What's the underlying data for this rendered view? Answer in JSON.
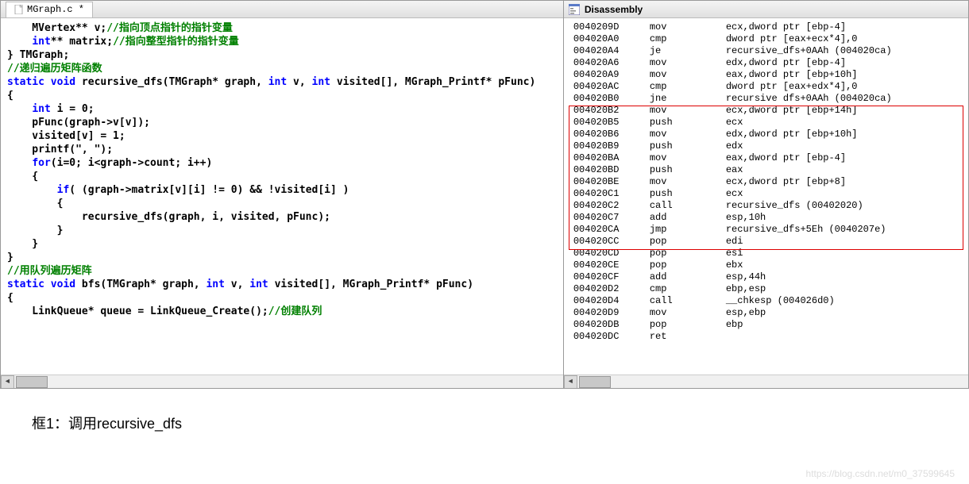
{
  "editor": {
    "tab_name": "MGraph.c *",
    "code_lines": [
      {
        "segments": [
          {
            "t": "    MVertex** v;",
            "c": "id"
          },
          {
            "t": "//指向顶点指针的指针变量",
            "c": "cmt"
          }
        ]
      },
      {
        "segments": [
          {
            "t": "    ",
            "c": "id"
          },
          {
            "t": "int",
            "c": "kw"
          },
          {
            "t": "** matrix;",
            "c": "id"
          },
          {
            "t": "//指向整型指针的指针变量",
            "c": "cmt"
          }
        ]
      },
      {
        "segments": [
          {
            "t": "} TMGraph;",
            "c": "id"
          }
        ]
      },
      {
        "segments": [
          {
            "t": "",
            "c": "id"
          }
        ]
      },
      {
        "segments": [
          {
            "t": "//递归遍历矩阵函数",
            "c": "cmt"
          }
        ]
      },
      {
        "segments": [
          {
            "t": "static void",
            "c": "kw"
          },
          {
            "t": " recursive_dfs(TMGraph* graph, ",
            "c": "id"
          },
          {
            "t": "int",
            "c": "kw"
          },
          {
            "t": " v, ",
            "c": "id"
          },
          {
            "t": "int",
            "c": "kw"
          },
          {
            "t": " visited[], MGraph_Printf* pFunc)",
            "c": "id"
          }
        ]
      },
      {
        "segments": [
          {
            "t": "{",
            "c": "id"
          }
        ]
      },
      {
        "segments": [
          {
            "t": "    ",
            "c": "id"
          },
          {
            "t": "int",
            "c": "kw"
          },
          {
            "t": " i = 0;",
            "c": "id"
          }
        ]
      },
      {
        "segments": [
          {
            "t": "",
            "c": "id"
          }
        ]
      },
      {
        "segments": [
          {
            "t": "    pFunc(graph->v[v]);",
            "c": "id"
          }
        ]
      },
      {
        "segments": [
          {
            "t": "",
            "c": "id"
          }
        ]
      },
      {
        "segments": [
          {
            "t": "    visited[v] = 1;",
            "c": "id"
          }
        ]
      },
      {
        "segments": [
          {
            "t": "",
            "c": "id"
          }
        ]
      },
      {
        "segments": [
          {
            "t": "    printf(\", \");",
            "c": "id"
          }
        ]
      },
      {
        "segments": [
          {
            "t": "",
            "c": "id"
          }
        ]
      },
      {
        "segments": [
          {
            "t": "    ",
            "c": "id"
          },
          {
            "t": "for",
            "c": "kw"
          },
          {
            "t": "(i=0; i<graph->count; i++)",
            "c": "id"
          }
        ]
      },
      {
        "segments": [
          {
            "t": "    {",
            "c": "id"
          }
        ]
      },
      {
        "segments": [
          {
            "t": "        ",
            "c": "id"
          },
          {
            "t": "if",
            "c": "kw"
          },
          {
            "t": "( (graph->matrix[v][i] != 0) && !visited[i] )",
            "c": "id"
          }
        ]
      },
      {
        "segments": [
          {
            "t": "        {",
            "c": "id"
          }
        ]
      },
      {
        "segments": [
          {
            "t": "            recursive_dfs(graph, i, visited, pFunc);",
            "c": "id"
          }
        ]
      },
      {
        "segments": [
          {
            "t": "        }",
            "c": "id"
          }
        ]
      },
      {
        "segments": [
          {
            "t": "    }",
            "c": "id"
          }
        ]
      },
      {
        "segments": [
          {
            "t": "}",
            "c": "id"
          }
        ]
      },
      {
        "segments": [
          {
            "t": "//用队列遍历矩阵",
            "c": "cmt"
          }
        ]
      },
      {
        "segments": [
          {
            "t": "static void",
            "c": "kw"
          },
          {
            "t": " bfs(TMGraph* graph, ",
            "c": "id"
          },
          {
            "t": "int",
            "c": "kw"
          },
          {
            "t": " v, ",
            "c": "id"
          },
          {
            "t": "int",
            "c": "kw"
          },
          {
            "t": " visited[], MGraph_Printf* pFunc)",
            "c": "id"
          }
        ]
      },
      {
        "segments": [
          {
            "t": "{",
            "c": "id"
          }
        ]
      },
      {
        "segments": [
          {
            "t": "    LinkQueue* queue = LinkQueue_Create();",
            "c": "id"
          },
          {
            "t": "//创建队列",
            "c": "cmt"
          }
        ]
      }
    ]
  },
  "disassembly": {
    "title": "Disassembly",
    "lines": [
      {
        "addr": "0040209D",
        "mnem": "mov",
        "oper": "ecx,dword ptr [ebp-4]"
      },
      {
        "addr": "004020A0",
        "mnem": "cmp",
        "oper": "dword ptr [eax+ecx*4],0"
      },
      {
        "addr": "004020A4",
        "mnem": "je",
        "oper": "recursive_dfs+0AAh (004020ca)"
      },
      {
        "addr": "004020A6",
        "mnem": "mov",
        "oper": "edx,dword ptr [ebp-4]"
      },
      {
        "addr": "004020A9",
        "mnem": "mov",
        "oper": "eax,dword ptr [ebp+10h]"
      },
      {
        "addr": "004020AC",
        "mnem": "cmp",
        "oper": "dword ptr [eax+edx*4],0"
      },
      {
        "addr": "004020B0",
        "mnem": "jne",
        "oper": "recursive dfs+0AAh (004020ca)"
      },
      {
        "addr": "004020B2",
        "mnem": "mov",
        "oper": "ecx,dword ptr [ebp+14h]"
      },
      {
        "addr": "004020B5",
        "mnem": "push",
        "oper": "ecx"
      },
      {
        "addr": "004020B6",
        "mnem": "mov",
        "oper": "edx,dword ptr [ebp+10h]"
      },
      {
        "addr": "004020B9",
        "mnem": "push",
        "oper": "edx"
      },
      {
        "addr": "004020BA",
        "mnem": "mov",
        "oper": "eax,dword ptr [ebp-4]"
      },
      {
        "addr": "004020BD",
        "mnem": "push",
        "oper": "eax"
      },
      {
        "addr": "004020BE",
        "mnem": "mov",
        "oper": "ecx,dword ptr [ebp+8]"
      },
      {
        "addr": "004020C1",
        "mnem": "push",
        "oper": "ecx"
      },
      {
        "addr": "004020C2",
        "mnem": "call",
        "oper": "recursive_dfs (00402020)"
      },
      {
        "addr": "004020C7",
        "mnem": "add",
        "oper": "esp,10h"
      },
      {
        "addr": "004020CA",
        "mnem": "jmp",
        "oper": "recursive_dfs+5Eh (0040207e)"
      },
      {
        "addr": "004020CC",
        "mnem": "pop",
        "oper": "edi"
      },
      {
        "addr": "004020CD",
        "mnem": "pop",
        "oper": "esi"
      },
      {
        "addr": "004020CE",
        "mnem": "pop",
        "oper": "ebx"
      },
      {
        "addr": "004020CF",
        "mnem": "add",
        "oper": "esp,44h"
      },
      {
        "addr": "004020D2",
        "mnem": "cmp",
        "oper": "ebp,esp"
      },
      {
        "addr": "004020D4",
        "mnem": "call",
        "oper": "__chkesp (004026d0)"
      },
      {
        "addr": "004020D9",
        "mnem": "mov",
        "oper": "esp,ebp"
      },
      {
        "addr": "004020DB",
        "mnem": "pop",
        "oper": "ebp"
      },
      {
        "addr": "004020DC",
        "mnem": "ret",
        "oper": ""
      }
    ]
  },
  "caption": "框1：调用recursive_dfs",
  "watermark": "https://blog.csdn.net/m0_37599645"
}
